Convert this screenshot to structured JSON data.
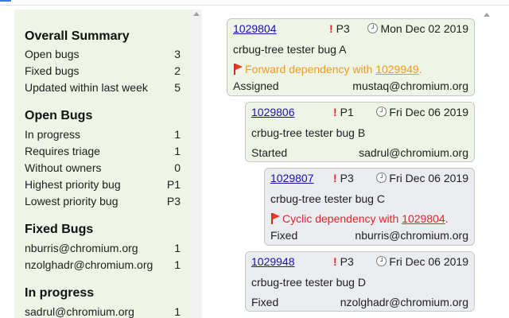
{
  "summary": {
    "overall": {
      "heading": "Overall Summary",
      "rows": [
        {
          "label": "Open bugs",
          "value": "3"
        },
        {
          "label": "Fixed bugs",
          "value": "2"
        },
        {
          "label": "Updated within last week",
          "value": "5"
        }
      ]
    },
    "open": {
      "heading": "Open Bugs",
      "rows": [
        {
          "label": "In progress",
          "value": "1"
        },
        {
          "label": "Requires triage",
          "value": "1"
        },
        {
          "label": "Without owners",
          "value": "0"
        },
        {
          "label": "Highest priority bug",
          "value": "P1"
        },
        {
          "label": "Lowest priority bug",
          "value": "P3"
        }
      ]
    },
    "fixed": {
      "heading": "Fixed Bugs",
      "rows": [
        {
          "label": "nburris@chromium.org",
          "value": "1"
        },
        {
          "label": "nzolghadr@chromium.org",
          "value": "1"
        }
      ]
    },
    "progress": {
      "heading": "In progress",
      "rows": [
        {
          "label": "sadrul@chromium.org",
          "value": "1"
        }
      ]
    }
  },
  "bugs": [
    {
      "id": "1029804",
      "priority": "P3",
      "date": "Mon Dec 02 2019",
      "title": "crbug-tree tester bug A",
      "note_text": "Forward dependency with ",
      "note_ref": "1029949",
      "note_end": ".",
      "status": "Assigned",
      "owner": "mustaq@chromium.org"
    },
    {
      "id": "1029806",
      "priority": "P1",
      "date": "Fri Dec 06 2019",
      "title": "crbug-tree tester bug B",
      "status": "Started",
      "owner": "sadrul@chromium.org"
    },
    {
      "id": "1029807",
      "priority": "P3",
      "date": "Fri Dec 06 2019",
      "title": "crbug-tree tester bug C",
      "note_text": "Cyclic dependency with ",
      "note_ref": "1029804",
      "note_end": ".",
      "status": "Fixed",
      "owner": "nburris@chromium.org"
    },
    {
      "id": "1029948",
      "priority": "P3",
      "date": "Fri Dec 06 2019",
      "title": "crbug-tree tester bug D",
      "status": "Fixed",
      "owner": "nzolghadr@chromium.org"
    }
  ],
  "colors": {
    "summary_bg": "#eef4e6",
    "card_green": "#eef4e6",
    "card_gray": "#eaecef",
    "link": "#1a0dab",
    "warning": "#f29a1c",
    "error": "#e8212e"
  },
  "icons": [
    "priority-exclamation-icon",
    "clock-icon",
    "flag-icon",
    "scroll-up-arrow-icon"
  ]
}
